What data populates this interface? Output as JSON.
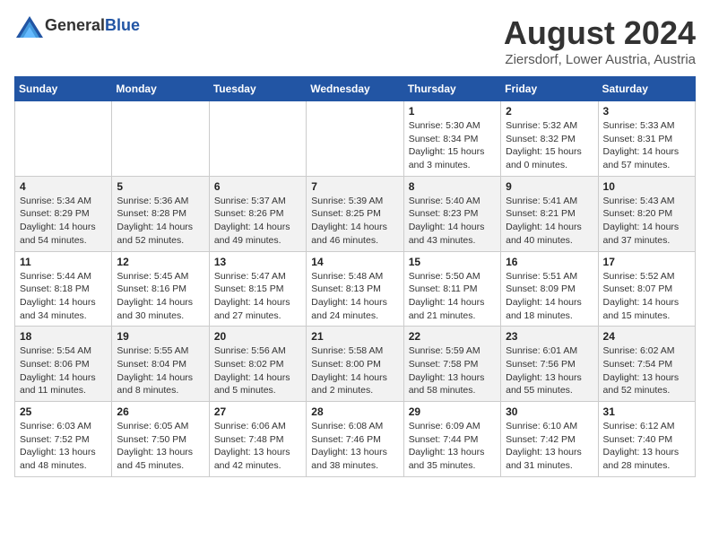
{
  "header": {
    "logo_general": "General",
    "logo_blue": "Blue",
    "month": "August 2024",
    "location": "Ziersdorf, Lower Austria, Austria"
  },
  "weekdays": [
    "Sunday",
    "Monday",
    "Tuesday",
    "Wednesday",
    "Thursday",
    "Friday",
    "Saturday"
  ],
  "weeks": [
    [
      {
        "day": "",
        "detail": ""
      },
      {
        "day": "",
        "detail": ""
      },
      {
        "day": "",
        "detail": ""
      },
      {
        "day": "",
        "detail": ""
      },
      {
        "day": "1",
        "detail": "Sunrise: 5:30 AM\nSunset: 8:34 PM\nDaylight: 15 hours\nand 3 minutes."
      },
      {
        "day": "2",
        "detail": "Sunrise: 5:32 AM\nSunset: 8:32 PM\nDaylight: 15 hours\nand 0 minutes."
      },
      {
        "day": "3",
        "detail": "Sunrise: 5:33 AM\nSunset: 8:31 PM\nDaylight: 14 hours\nand 57 minutes."
      }
    ],
    [
      {
        "day": "4",
        "detail": "Sunrise: 5:34 AM\nSunset: 8:29 PM\nDaylight: 14 hours\nand 54 minutes."
      },
      {
        "day": "5",
        "detail": "Sunrise: 5:36 AM\nSunset: 8:28 PM\nDaylight: 14 hours\nand 52 minutes."
      },
      {
        "day": "6",
        "detail": "Sunrise: 5:37 AM\nSunset: 8:26 PM\nDaylight: 14 hours\nand 49 minutes."
      },
      {
        "day": "7",
        "detail": "Sunrise: 5:39 AM\nSunset: 8:25 PM\nDaylight: 14 hours\nand 46 minutes."
      },
      {
        "day": "8",
        "detail": "Sunrise: 5:40 AM\nSunset: 8:23 PM\nDaylight: 14 hours\nand 43 minutes."
      },
      {
        "day": "9",
        "detail": "Sunrise: 5:41 AM\nSunset: 8:21 PM\nDaylight: 14 hours\nand 40 minutes."
      },
      {
        "day": "10",
        "detail": "Sunrise: 5:43 AM\nSunset: 8:20 PM\nDaylight: 14 hours\nand 37 minutes."
      }
    ],
    [
      {
        "day": "11",
        "detail": "Sunrise: 5:44 AM\nSunset: 8:18 PM\nDaylight: 14 hours\nand 34 minutes."
      },
      {
        "day": "12",
        "detail": "Sunrise: 5:45 AM\nSunset: 8:16 PM\nDaylight: 14 hours\nand 30 minutes."
      },
      {
        "day": "13",
        "detail": "Sunrise: 5:47 AM\nSunset: 8:15 PM\nDaylight: 14 hours\nand 27 minutes."
      },
      {
        "day": "14",
        "detail": "Sunrise: 5:48 AM\nSunset: 8:13 PM\nDaylight: 14 hours\nand 24 minutes."
      },
      {
        "day": "15",
        "detail": "Sunrise: 5:50 AM\nSunset: 8:11 PM\nDaylight: 14 hours\nand 21 minutes."
      },
      {
        "day": "16",
        "detail": "Sunrise: 5:51 AM\nSunset: 8:09 PM\nDaylight: 14 hours\nand 18 minutes."
      },
      {
        "day": "17",
        "detail": "Sunrise: 5:52 AM\nSunset: 8:07 PM\nDaylight: 14 hours\nand 15 minutes."
      }
    ],
    [
      {
        "day": "18",
        "detail": "Sunrise: 5:54 AM\nSunset: 8:06 PM\nDaylight: 14 hours\nand 11 minutes."
      },
      {
        "day": "19",
        "detail": "Sunrise: 5:55 AM\nSunset: 8:04 PM\nDaylight: 14 hours\nand 8 minutes."
      },
      {
        "day": "20",
        "detail": "Sunrise: 5:56 AM\nSunset: 8:02 PM\nDaylight: 14 hours\nand 5 minutes."
      },
      {
        "day": "21",
        "detail": "Sunrise: 5:58 AM\nSunset: 8:00 PM\nDaylight: 14 hours\nand 2 minutes."
      },
      {
        "day": "22",
        "detail": "Sunrise: 5:59 AM\nSunset: 7:58 PM\nDaylight: 13 hours\nand 58 minutes."
      },
      {
        "day": "23",
        "detail": "Sunrise: 6:01 AM\nSunset: 7:56 PM\nDaylight: 13 hours\nand 55 minutes."
      },
      {
        "day": "24",
        "detail": "Sunrise: 6:02 AM\nSunset: 7:54 PM\nDaylight: 13 hours\nand 52 minutes."
      }
    ],
    [
      {
        "day": "25",
        "detail": "Sunrise: 6:03 AM\nSunset: 7:52 PM\nDaylight: 13 hours\nand 48 minutes."
      },
      {
        "day": "26",
        "detail": "Sunrise: 6:05 AM\nSunset: 7:50 PM\nDaylight: 13 hours\nand 45 minutes."
      },
      {
        "day": "27",
        "detail": "Sunrise: 6:06 AM\nSunset: 7:48 PM\nDaylight: 13 hours\nand 42 minutes."
      },
      {
        "day": "28",
        "detail": "Sunrise: 6:08 AM\nSunset: 7:46 PM\nDaylight: 13 hours\nand 38 minutes."
      },
      {
        "day": "29",
        "detail": "Sunrise: 6:09 AM\nSunset: 7:44 PM\nDaylight: 13 hours\nand 35 minutes."
      },
      {
        "day": "30",
        "detail": "Sunrise: 6:10 AM\nSunset: 7:42 PM\nDaylight: 13 hours\nand 31 minutes."
      },
      {
        "day": "31",
        "detail": "Sunrise: 6:12 AM\nSunset: 7:40 PM\nDaylight: 13 hours\nand 28 minutes."
      }
    ]
  ]
}
